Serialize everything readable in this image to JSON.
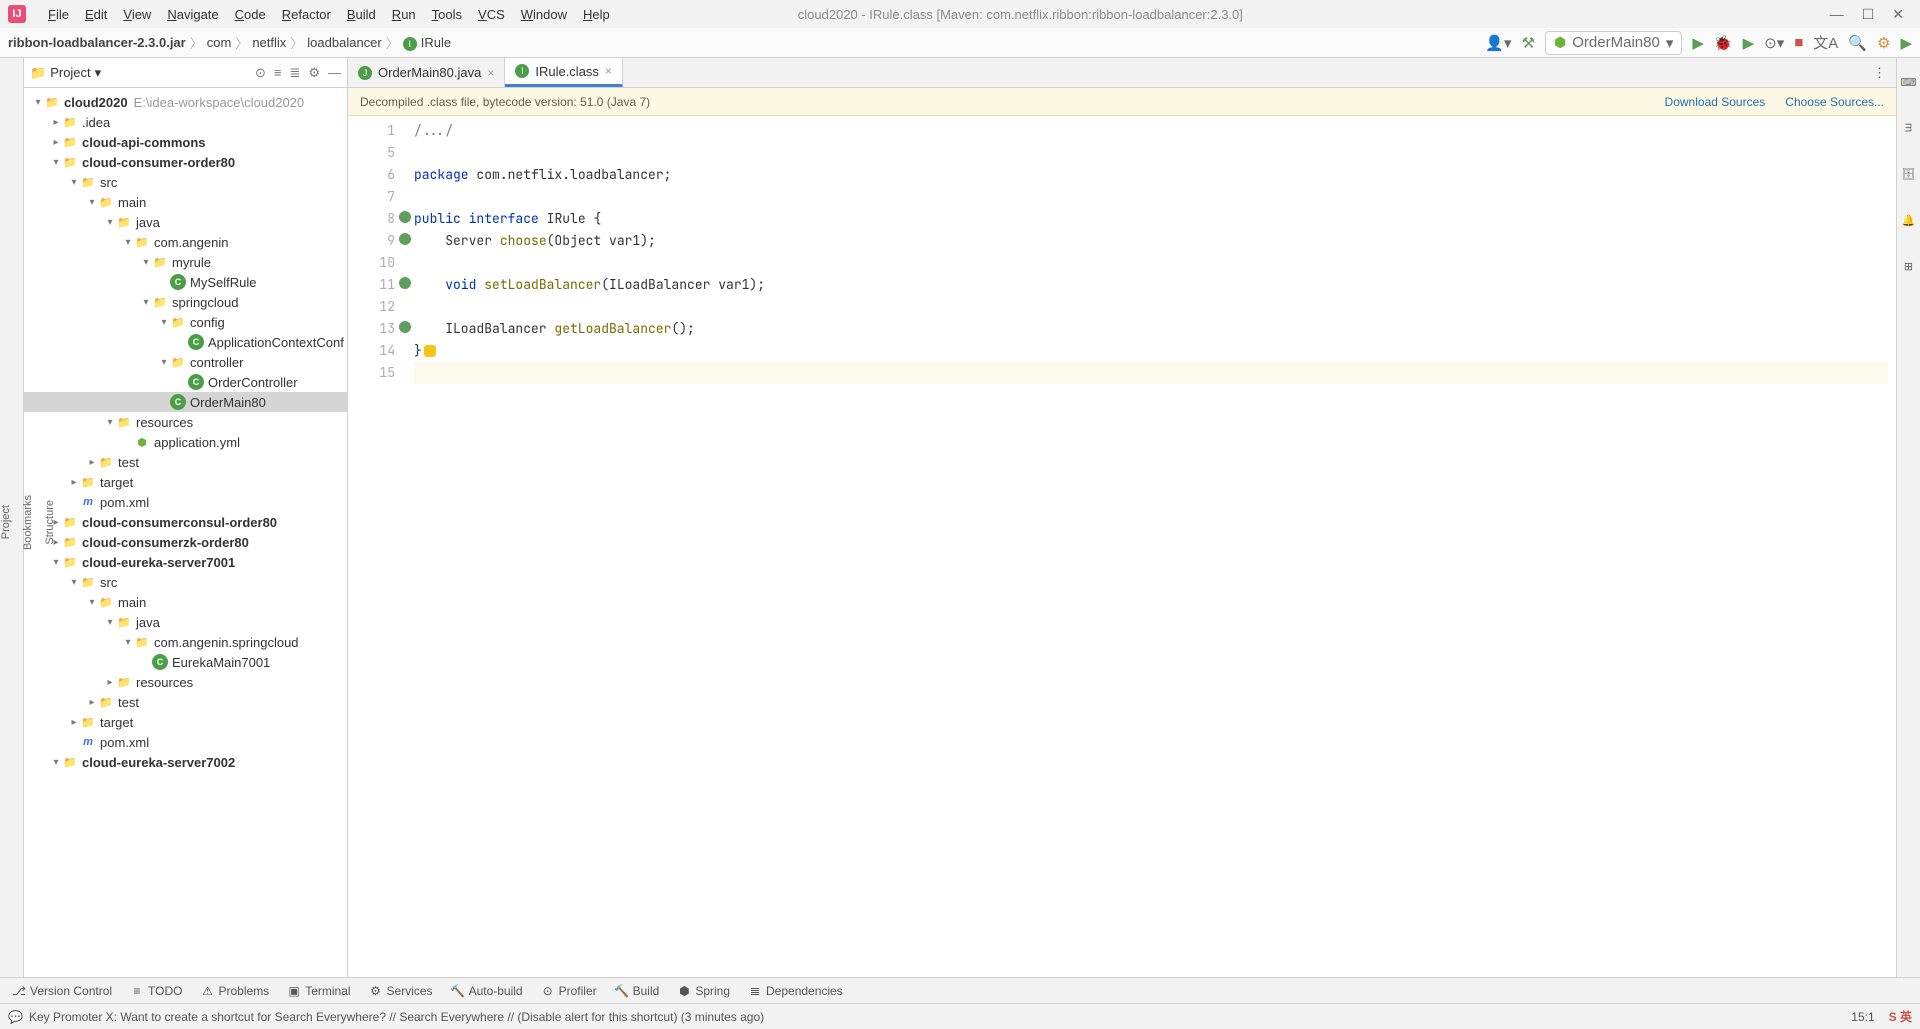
{
  "app_icon": "IJ",
  "menu": [
    "File",
    "Edit",
    "View",
    "Navigate",
    "Code",
    "Refactor",
    "Build",
    "Run",
    "Tools",
    "VCS",
    "Window",
    "Help"
  ],
  "window_title": "cloud2020 - IRule.class [Maven: com.netflix.ribbon:ribbon-loadbalancer:2.3.0]",
  "breadcrumb": [
    "ribbon-loadbalancer-2.3.0.jar",
    "com",
    "netflix",
    "loadbalancer",
    "IRule"
  ],
  "run_config": "OrderMain80",
  "project_label": "Project",
  "tree": [
    {
      "d": 0,
      "a": "v",
      "ic": "folder-module",
      "name": "cloud2020",
      "hint": "E:\\idea-workspace\\cloud2020",
      "bold": true
    },
    {
      "d": 1,
      "a": ">",
      "ic": "folder",
      "name": ".idea"
    },
    {
      "d": 1,
      "a": ">",
      "ic": "folder-module",
      "name": "cloud-api-commons",
      "bold": true
    },
    {
      "d": 1,
      "a": "v",
      "ic": "folder-module",
      "name": "cloud-consumer-order80",
      "bold": true
    },
    {
      "d": 2,
      "a": "v",
      "ic": "folder-src",
      "name": "src"
    },
    {
      "d": 3,
      "a": "v",
      "ic": "folder",
      "name": "main"
    },
    {
      "d": 4,
      "a": "v",
      "ic": "folder-src",
      "name": "java"
    },
    {
      "d": 5,
      "a": "v",
      "ic": "folder",
      "name": "com.angenin"
    },
    {
      "d": 6,
      "a": "v",
      "ic": "folder",
      "name": "myrule"
    },
    {
      "d": 7,
      "a": "",
      "ic": "java",
      "name": "MySelfRule"
    },
    {
      "d": 6,
      "a": "v",
      "ic": "folder",
      "name": "springcloud"
    },
    {
      "d": 7,
      "a": "v",
      "ic": "folder",
      "name": "config"
    },
    {
      "d": 8,
      "a": "",
      "ic": "java",
      "name": "ApplicationContextConf"
    },
    {
      "d": 7,
      "a": "v",
      "ic": "folder",
      "name": "controller"
    },
    {
      "d": 8,
      "a": "",
      "ic": "java",
      "name": "OrderController"
    },
    {
      "d": 7,
      "a": "",
      "ic": "java",
      "name": "OrderMain80",
      "sel": true
    },
    {
      "d": 4,
      "a": "v",
      "ic": "folder",
      "name": "resources"
    },
    {
      "d": 5,
      "a": "",
      "ic": "spring",
      "name": "application.yml"
    },
    {
      "d": 3,
      "a": ">",
      "ic": "folder",
      "name": "test"
    },
    {
      "d": 2,
      "a": ">",
      "ic": "folder-target",
      "name": "target"
    },
    {
      "d": 2,
      "a": "",
      "ic": "maven",
      "name": "pom.xml"
    },
    {
      "d": 1,
      "a": ">",
      "ic": "folder-module",
      "name": "cloud-consumerconsul-order80",
      "bold": true
    },
    {
      "d": 1,
      "a": ">",
      "ic": "folder-module",
      "name": "cloud-consumerzk-order80",
      "bold": true
    },
    {
      "d": 1,
      "a": "v",
      "ic": "folder-module",
      "name": "cloud-eureka-server7001",
      "bold": true
    },
    {
      "d": 2,
      "a": "v",
      "ic": "folder-src",
      "name": "src"
    },
    {
      "d": 3,
      "a": "v",
      "ic": "folder",
      "name": "main"
    },
    {
      "d": 4,
      "a": "v",
      "ic": "folder-src",
      "name": "java"
    },
    {
      "d": 5,
      "a": "v",
      "ic": "folder",
      "name": "com.angenin.springcloud"
    },
    {
      "d": 6,
      "a": "",
      "ic": "java",
      "name": "EurekaMain7001"
    },
    {
      "d": 4,
      "a": ">",
      "ic": "folder",
      "name": "resources"
    },
    {
      "d": 3,
      "a": ">",
      "ic": "folder",
      "name": "test"
    },
    {
      "d": 2,
      "a": ">",
      "ic": "folder-target",
      "name": "target"
    },
    {
      "d": 2,
      "a": "",
      "ic": "maven",
      "name": "pom.xml"
    },
    {
      "d": 1,
      "a": "v",
      "ic": "folder-module",
      "name": "cloud-eureka-server7002",
      "bold": true
    }
  ],
  "tabs": [
    {
      "ic": "j",
      "label": "OrderMain80.java",
      "active": false
    },
    {
      "ic": "i",
      "label": "IRule.class",
      "active": true
    }
  ],
  "banner_text": "Decompiled .class file, bytecode version: 51.0 (Java 7)",
  "banner_links": [
    "Download Sources",
    "Choose Sources..."
  ],
  "code": {
    "lines": [
      {
        "n": 1,
        "html": "<span class='com'>/.../</span>"
      },
      {
        "n": 5,
        "html": ""
      },
      {
        "n": 6,
        "html": "<span class='kw'>package</span> <span class='pkg'>com.netflix.loadbalancer;</span>"
      },
      {
        "n": 7,
        "html": ""
      },
      {
        "n": 8,
        "marker": "impl",
        "html": "<span class='kw'>public</span> <span class='kw'>interface</span> <span class='cls'>IRule</span> {"
      },
      {
        "n": 9,
        "marker": "impl",
        "html": "    Server <span class='fn'>choose</span>(Object var1);"
      },
      {
        "n": 10,
        "html": ""
      },
      {
        "n": 11,
        "marker": "impl",
        "html": "    <span class='kw'>void</span> <span class='fn'>setLoadBalancer</span>(ILoadBalancer var1);"
      },
      {
        "n": 12,
        "html": ""
      },
      {
        "n": 13,
        "marker": "impl",
        "html": "    ILoadBalancer <span class='fn'>getLoadBalancer</span>();"
      },
      {
        "n": 14,
        "html": "}<span class='bulb'></span>"
      },
      {
        "n": 15,
        "html": "",
        "hl": true
      }
    ]
  },
  "tool_windows": [
    "Version Control",
    "TODO",
    "Problems",
    "Terminal",
    "Services",
    "Auto-build",
    "Profiler",
    "Build",
    "Spring",
    "Dependencies"
  ],
  "status_msg": "Key Promoter X: Want to create a shortcut for Search Everywhere? // Search Everywhere // (Disable alert for this shortcut) (3 minutes ago)",
  "caret_pos": "15:1",
  "left_gutter": [
    "Project",
    "Bookmarks",
    "Structure"
  ],
  "right_gutter": [
    "Key Promoter X",
    "Maven",
    "Database",
    "Notifications",
    "Hierarchy"
  ]
}
